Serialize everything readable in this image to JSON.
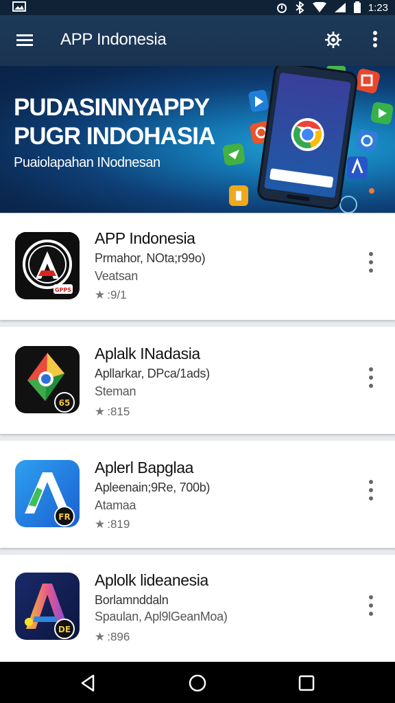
{
  "status_bar": {
    "time": "1:23"
  },
  "app_bar": {
    "title": "APP Indonesia"
  },
  "banner": {
    "headline_line1": "PUDASINNYAPPY",
    "headline_line2": "PUGR INDOHASIA",
    "subline": "Puaiolapahan INodnesan"
  },
  "apps": [
    {
      "name": "APP Indonesia",
      "line2": "Prmahor, NOta;r99o)",
      "line3": "Veatsan",
      "rating": ":9/1",
      "badge": "GPPS"
    },
    {
      "name": "Aplalk INadasia",
      "line2": "Apllarkar, DPca/1ads)",
      "line3": "Steman",
      "rating": ":815",
      "badge": "65"
    },
    {
      "name": "Aplerl Bapglaa",
      "line2": "Apleenain;9Re, 700b)",
      "line3": "Atamaa",
      "rating": ":819",
      "badge": "FR"
    },
    {
      "name": "Aplolk lideanesia",
      "line2": "Borlamnddaln",
      "line3": "Spaulan, Apl9lGeanMoa)",
      "rating": ":896",
      "badge": "DE"
    }
  ],
  "colors": {
    "app_bar": "#1a3350",
    "status_bar": "#0f2236",
    "nav_bar": "#000000"
  }
}
